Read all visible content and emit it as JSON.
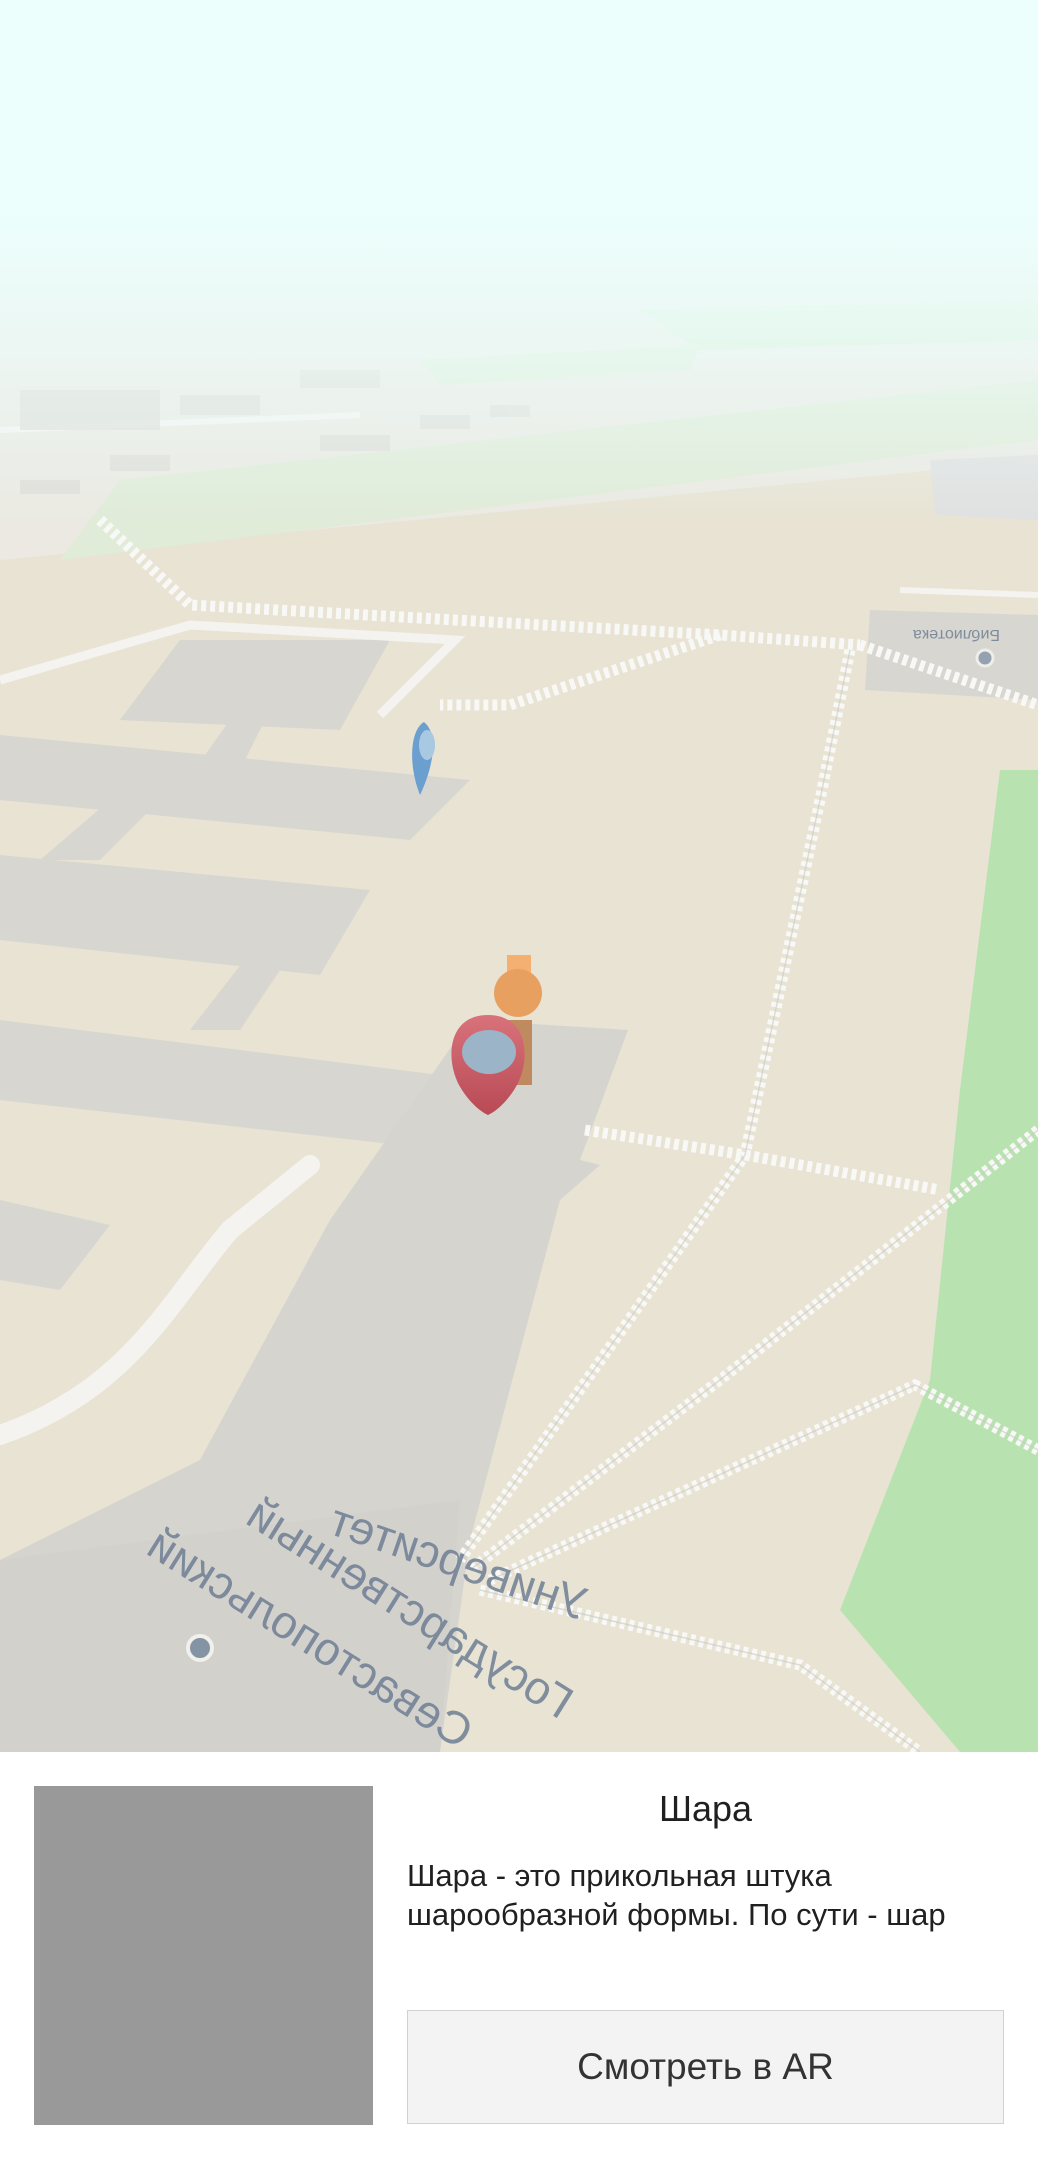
{
  "map": {
    "street_label_1": "Университет",
    "street_label_2": "Государственный",
    "street_label_3": "Севастопольский",
    "building_label": "Библиотека",
    "colors": {
      "sky": "#ecfffd",
      "ground": "#e8e3d3",
      "building": "#d8d6d0",
      "park": "#b8e3b0",
      "path": "#f2f2ee",
      "marker_red": "#c9606a",
      "marker_blue": "#6a9fd0",
      "player": "#e8a060"
    }
  },
  "panel": {
    "title": "Шара",
    "description": "Шара - это прикольная штука шарообразной формы. По сути - шар",
    "ar_button_label": "Смотреть в AR",
    "thumbnail_color": "#999999"
  }
}
